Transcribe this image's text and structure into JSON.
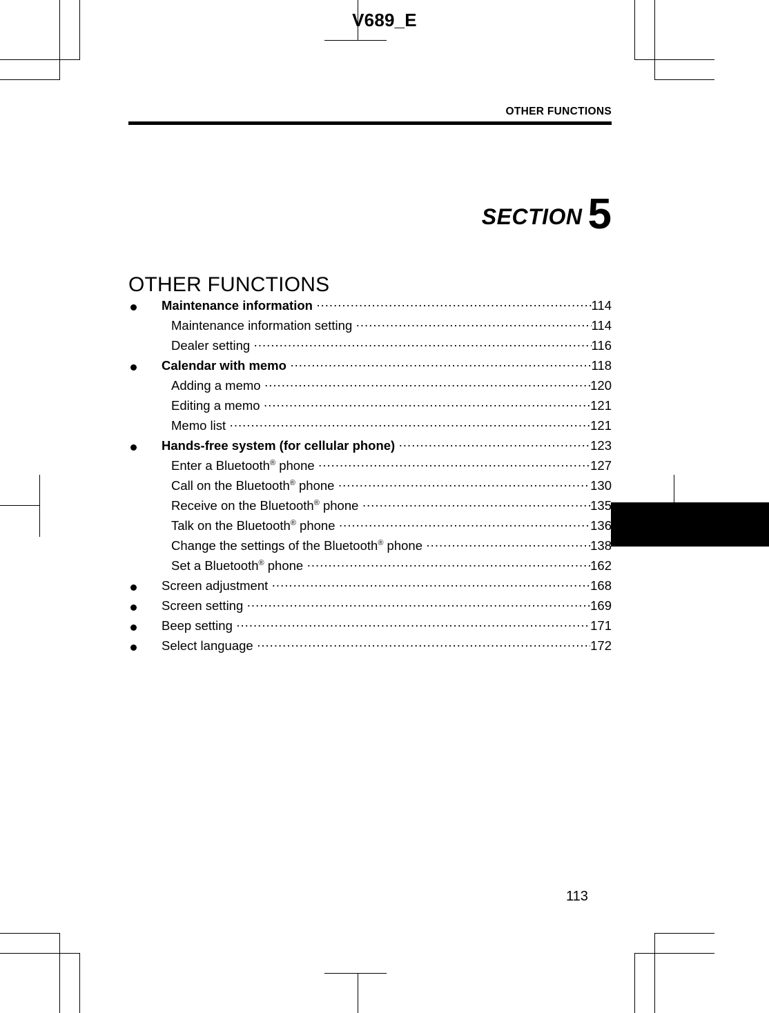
{
  "book_code": "V689_E",
  "running_head": "OTHER FUNCTIONS",
  "section": {
    "word": "SECTION",
    "number": "5",
    "title": "OTHER FUNCTIONS"
  },
  "folio": "113",
  "leader_char": "·",
  "bullet_glyph": "●",
  "toc": [
    {
      "level": 1,
      "bullet": true,
      "label": "Maintenance information",
      "page": "114"
    },
    {
      "level": 2,
      "bullet": false,
      "label": "Maintenance information setting",
      "page": "114"
    },
    {
      "level": 2,
      "bullet": false,
      "label": "Dealer setting",
      "page": "116"
    },
    {
      "level": 1,
      "bullet": true,
      "label": "Calendar with memo",
      "page": "118"
    },
    {
      "level": 2,
      "bullet": false,
      "label": "Adding a memo",
      "page": "120"
    },
    {
      "level": 2,
      "bullet": false,
      "label": "Editing a memo",
      "page": "121"
    },
    {
      "level": 2,
      "bullet": false,
      "label": "Memo list",
      "page": "121"
    },
    {
      "level": 1,
      "bullet": true,
      "label": "Hands-free system (for cellular phone)",
      "page": "123"
    },
    {
      "level": 2,
      "bullet": false,
      "label": "Enter a Bluetooth® phone",
      "page": "127",
      "reg_after": "Bluetooth"
    },
    {
      "level": 2,
      "bullet": false,
      "label": "Call on the Bluetooth® phone",
      "page": "130",
      "reg_after": "Bluetooth"
    },
    {
      "level": 2,
      "bullet": false,
      "label": "Receive on the Bluetooth® phone",
      "page": "135",
      "reg_after": "Bluetooth"
    },
    {
      "level": 2,
      "bullet": false,
      "label": "Talk on the Bluetooth® phone",
      "page": "136",
      "reg_after": "Bluetooth"
    },
    {
      "level": 2,
      "bullet": false,
      "label": "Change the settings of the Bluetooth® phone",
      "page": "138",
      "reg_after": "Bluetooth"
    },
    {
      "level": 2,
      "bullet": false,
      "label": "Set a Bluetooth® phone",
      "page": "162",
      "reg_after": "Bluetooth"
    },
    {
      "level": 1,
      "bullet": true,
      "label": "Screen adjustment",
      "page": "168",
      "bold": false
    },
    {
      "level": 1,
      "bullet": true,
      "label": "Screen setting",
      "page": "169",
      "bold": false
    },
    {
      "level": 1,
      "bullet": true,
      "label": "Beep setting",
      "page": "171",
      "bold": false
    },
    {
      "level": 1,
      "bullet": true,
      "label": "Select language",
      "page": "172",
      "bold": false
    }
  ],
  "crop_marks": {
    "description": "printer registration and trim marks",
    "corners": [
      "top-left",
      "top-right",
      "bottom-left",
      "bottom-right"
    ],
    "center_marks": [
      "top-center",
      "bottom-center",
      "left-middle"
    ]
  },
  "thumb_tab": {
    "color": "#000000"
  }
}
